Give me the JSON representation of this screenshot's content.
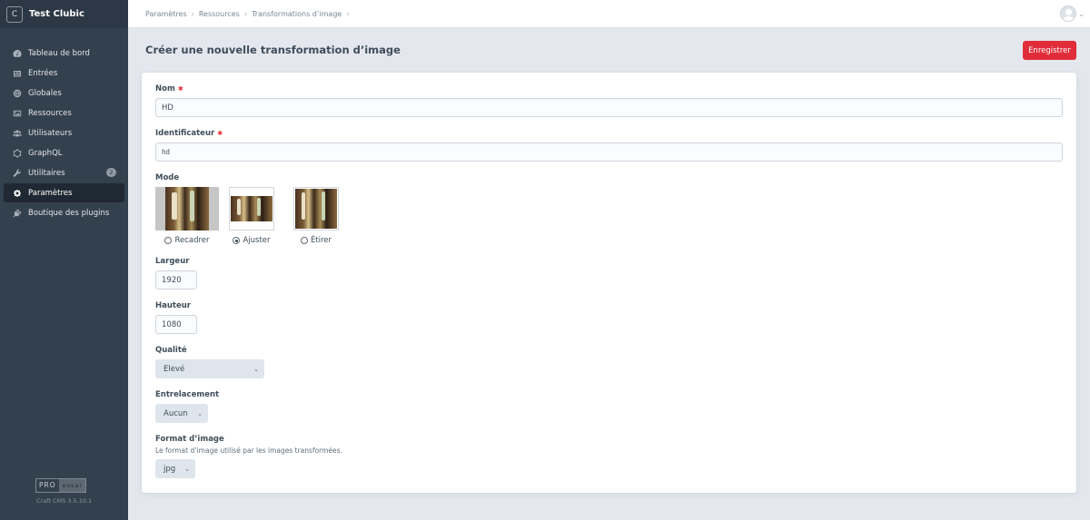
{
  "app": {
    "name": "Test Clubic",
    "logo_letter": "C"
  },
  "sidebar": {
    "items": [
      {
        "label": "Tableau de bord",
        "icon": "gauge-icon",
        "active": false
      },
      {
        "label": "Entrées",
        "icon": "newspaper-icon",
        "active": false
      },
      {
        "label": "Globales",
        "icon": "globe-icon",
        "active": false
      },
      {
        "label": "Ressources",
        "icon": "image-icon",
        "active": false
      },
      {
        "label": "Utilisateurs",
        "icon": "users-icon",
        "active": false
      },
      {
        "label": "GraphQL",
        "icon": "graphql-icon",
        "active": false
      },
      {
        "label": "Utilitaires",
        "icon": "wrench-icon",
        "active": false,
        "badge": "2"
      },
      {
        "label": "Paramètres",
        "icon": "gear-icon",
        "active": true
      },
      {
        "label": "Boutique des plugins",
        "icon": "plug-icon",
        "active": false
      }
    ],
    "edition": {
      "name": "PRO",
      "status": "essai"
    },
    "version": "Craft CMS 3.5.10.1"
  },
  "header": {
    "breadcrumbs": [
      "Paramètres",
      "Ressources",
      "Transformations d’image"
    ]
  },
  "page": {
    "title": "Créer une nouvelle transformation d’image",
    "save_label": "Enregistrer"
  },
  "form": {
    "name": {
      "label": "Nom",
      "value": "HD"
    },
    "handle": {
      "label": "Identificateur",
      "value": "hd"
    },
    "mode": {
      "label": "Mode",
      "options": [
        {
          "label": "Recadrer",
          "checked": false
        },
        {
          "label": "Ajuster",
          "checked": true
        },
        {
          "label": "Étirer",
          "checked": false
        }
      ]
    },
    "width": {
      "label": "Largeur",
      "value": "1920"
    },
    "height": {
      "label": "Hauteur",
      "value": "1080"
    },
    "quality": {
      "label": "Qualité",
      "value": "Elevé"
    },
    "interlace": {
      "label": "Entrelacement",
      "value": "Aucun"
    },
    "format": {
      "label": "Format d’image",
      "instructions": "Le format d’image utilisé par les images transformées.",
      "value": "jpg"
    }
  },
  "colors": {
    "accent": "#e12d39",
    "sidebar": "#33404d"
  }
}
